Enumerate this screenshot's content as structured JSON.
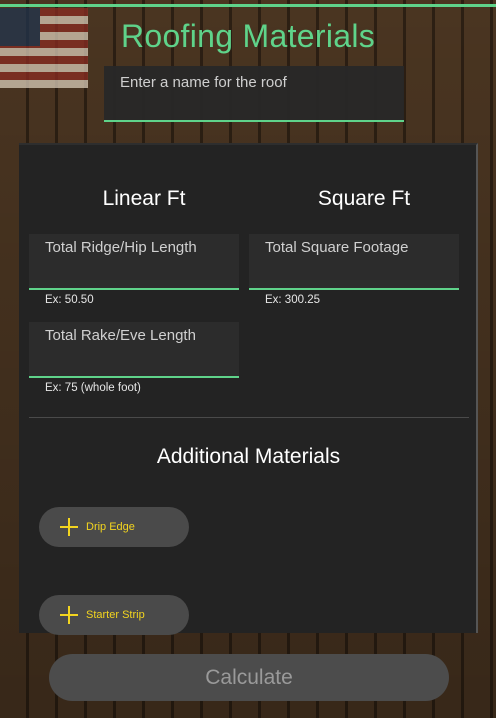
{
  "header": {
    "title": "Roofing Materials",
    "roof_name_placeholder": "Enter a name for the roof"
  },
  "linear": {
    "heading": "Linear Ft",
    "ridge_placeholder": "Total Ridge/Hip Length",
    "ridge_hint": "Ex: 50.50",
    "rake_placeholder": "Total Rake/Eve Length",
    "rake_hint": "Ex: 75 (whole foot)"
  },
  "square": {
    "heading": "Square Ft",
    "footage_placeholder": "Total Square Footage",
    "footage_hint": "Ex: 300.25"
  },
  "additional": {
    "heading": "Additional Materials",
    "items": [
      {
        "label": "Drip Edge",
        "icon": "plus-icon"
      },
      {
        "label": "Starter Strip",
        "icon": "plus-icon"
      }
    ]
  },
  "actions": {
    "calculate_label": "Calculate"
  },
  "colors": {
    "accent": "#5fd38a",
    "material_accent": "#f2d41f",
    "panel": "#232323"
  }
}
